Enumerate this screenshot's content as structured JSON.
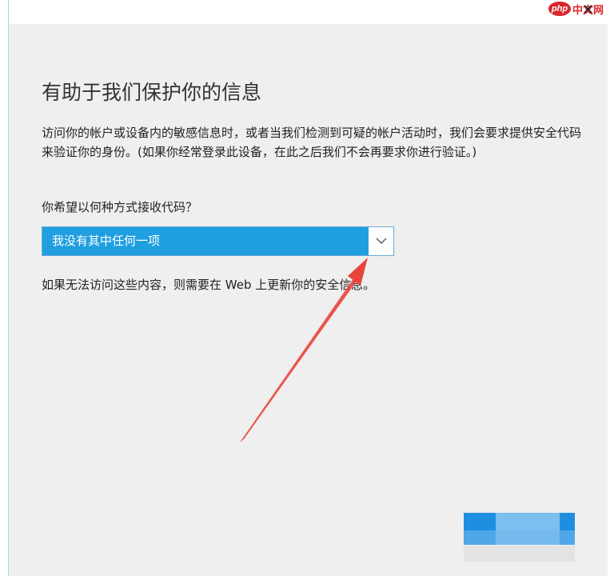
{
  "watermark": {
    "badge": "php",
    "text": "中文网"
  },
  "window": {
    "close_glyph": "✕"
  },
  "dialog": {
    "title": "有助于我们保护你的信息",
    "description": "访问你的帐户或设备内的敏感信息时，或者当我们检测到可疑的帐户活动时，我们会要求提供安全代码来验证你的身份。(如果你经常登录此设备，在此之后我们不会再要求你进行验证。)",
    "question": "你希望以何种方式接收代码？",
    "dropdown": {
      "selected": "我没有其中任何一项"
    },
    "help_text": "如果无法访问这些内容，则需要在 Web 上更新你的安全信息。"
  },
  "colors": {
    "accent": "#1f9fe0",
    "annotation_arrow": "#e8443c",
    "panel_bg": "#efefef"
  },
  "icons": {
    "dropdown": "chevron-down-icon",
    "close": "close-icon",
    "annotation": "arrow-annotation"
  }
}
